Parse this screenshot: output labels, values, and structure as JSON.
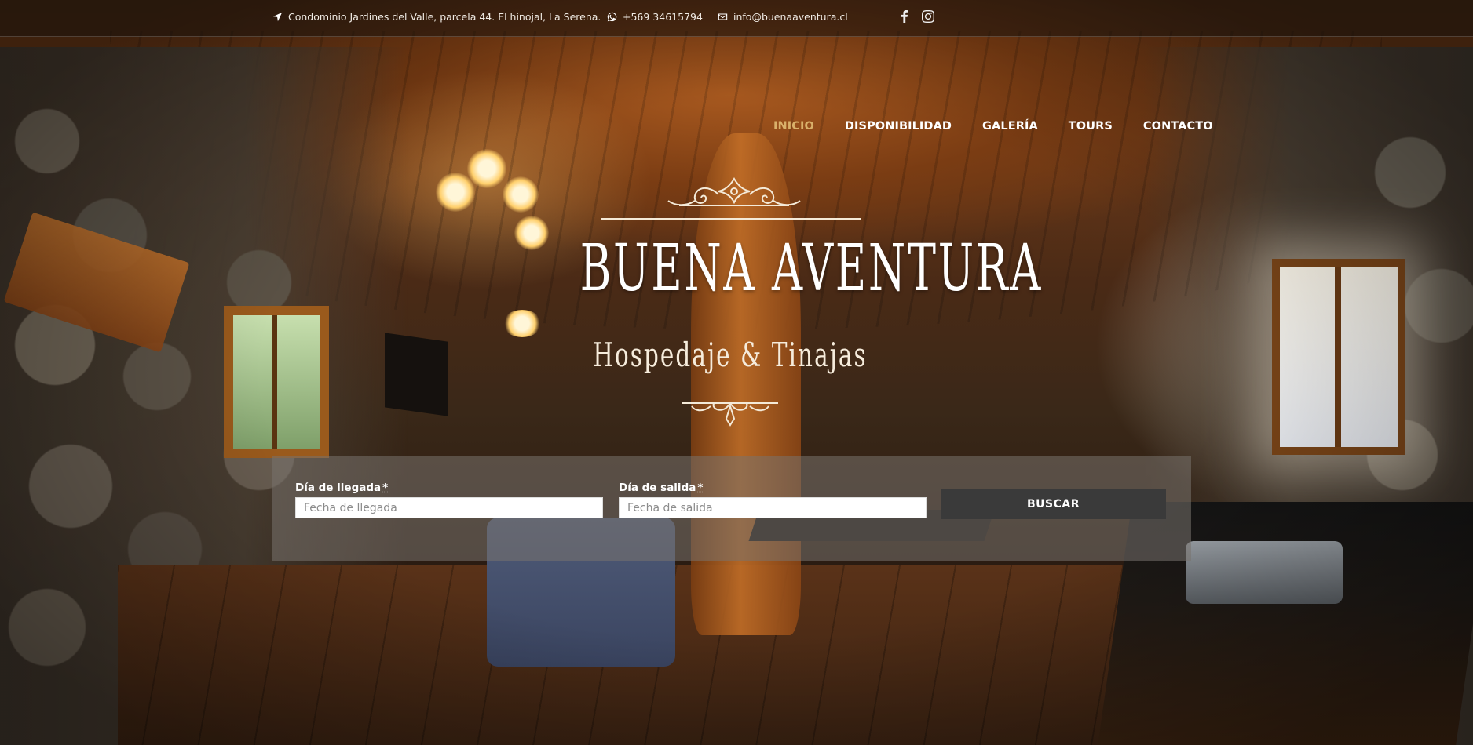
{
  "topbar": {
    "address": "Condominio Jardines del Valle, parcela 44. El hinojal, La Serena.",
    "phone": "+569 34615794",
    "email": "info@buenaaventura.cl",
    "icons": [
      "location-arrow-icon",
      "whatsapp-icon",
      "envelope-icon",
      "facebook-icon",
      "instagram-icon"
    ]
  },
  "nav": {
    "items": [
      {
        "label": "INICIO",
        "active": true
      },
      {
        "label": "DISPONIBILIDAD",
        "active": false
      },
      {
        "label": "GALERÍA",
        "active": false
      },
      {
        "label": "TOURS",
        "active": false
      },
      {
        "label": "CONTACTO",
        "active": false
      }
    ],
    "active_color": "#d9b06a"
  },
  "logo": {
    "name": "BUENA AVENTURA",
    "tagline": "Hospedaje & Tinajas"
  },
  "booking": {
    "arrival_label": "Día de llegada",
    "arrival_placeholder": "Fecha de llegada",
    "departure_label": "Día de salida",
    "departure_placeholder": "Fecha de salida",
    "required_mark": "*",
    "button_label": "BUSCAR"
  }
}
